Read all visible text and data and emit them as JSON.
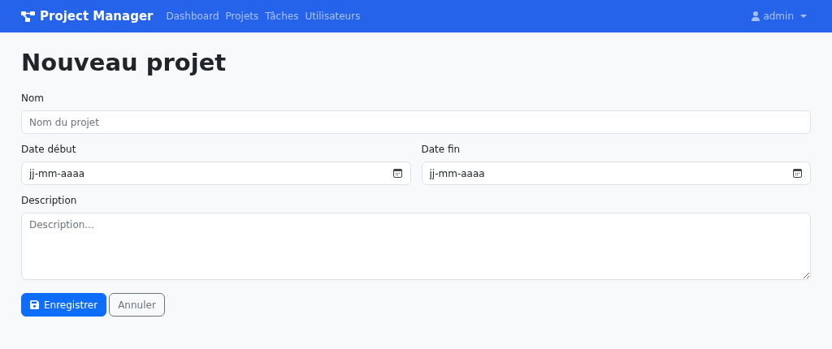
{
  "navbar": {
    "brand": "Project Manager",
    "links": [
      {
        "label": "Dashboard",
        "selected": false
      },
      {
        "label": "Projets",
        "selected": false
      },
      {
        "label": "Tâches",
        "selected": false
      },
      {
        "label": "Utilisateurs",
        "selected": false
      }
    ],
    "user": "admin"
  },
  "title": "Nouveau projet",
  "fields": [
    {
      "kind": "text",
      "label": "Nom",
      "placeholder": "Nom du projet"
    },
    {
      "kind": "date",
      "label": "Date début",
      "placeholder": "jj-mm-aaaa"
    },
    {
      "kind": "date",
      "label": "Date fin",
      "placeholder": "jj-mm-aaaa"
    },
    {
      "kind": "textarea",
      "label": "Description",
      "placeholder": "Description..."
    }
  ],
  "buttons": [
    {
      "kind": "primary",
      "label": "Enregistrer"
    },
    {
      "kind": "secondary",
      "label": "Annuler"
    }
  ]
}
